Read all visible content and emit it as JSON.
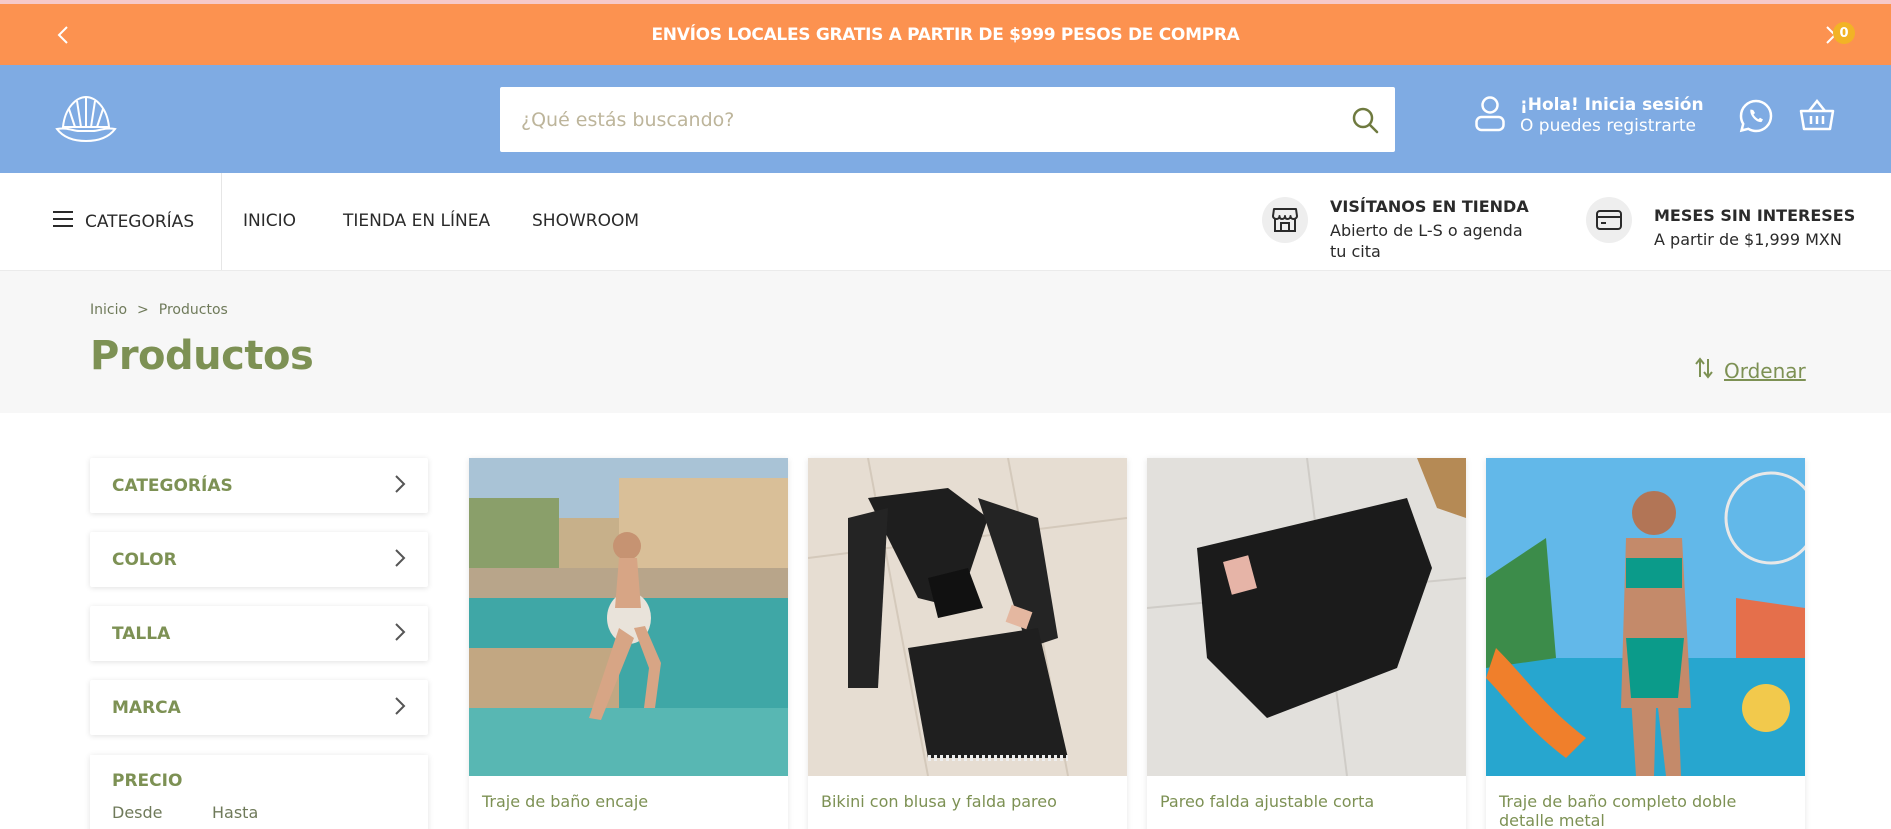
{
  "announcement": {
    "text": "ENVÍOS LOCALES GRATIS A PARTIR DE $999 PESOS DE COMPRA"
  },
  "search": {
    "placeholder": "¿Qué estás buscando?"
  },
  "user": {
    "greeting": "¡Hola! Inicia sesión",
    "register": "O puedes registrarte"
  },
  "cart": {
    "count": "0"
  },
  "nav": {
    "categories_label": "CATEGORÍAS",
    "links": [
      "INICIO",
      "TIENDA EN LÍNEA",
      "SHOWROOM"
    ],
    "store_info": {
      "title": "VISÍTANOS EN TIENDA",
      "line1": "Abierto de L-S o agenda",
      "line2": "tu cita"
    },
    "msi_info": {
      "title": "MESES SIN INTERESES",
      "line1": "A partir de $1,999 MXN"
    }
  },
  "breadcrumb": {
    "home": "Inicio",
    "separator": ">",
    "current": "Productos"
  },
  "page": {
    "title": "Productos",
    "sort_label": "Ordenar"
  },
  "filters": {
    "items": [
      "CATEGORÍAS",
      "COLOR",
      "TALLA",
      "MARCA"
    ],
    "price": {
      "title": "PRECIO",
      "from": "Desde",
      "to": "Hasta"
    }
  },
  "products": [
    {
      "name": "Traje de baño encaje"
    },
    {
      "name": "Bikini con blusa y falda pareo"
    },
    {
      "name": "Pareo falda ajustable corta"
    },
    {
      "name": "Traje de baño completo doble detalle metal"
    }
  ],
  "colors": {
    "announce": "#fc9250",
    "header": "#7fabe3",
    "accent": "#7d9154",
    "badge": "#f2b326"
  }
}
